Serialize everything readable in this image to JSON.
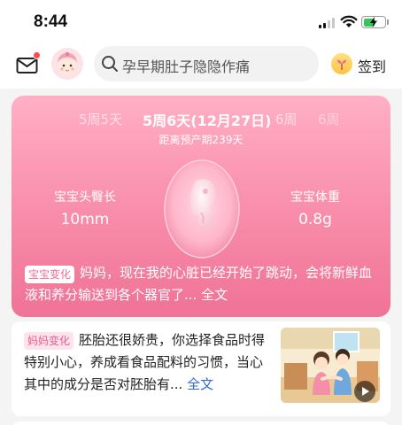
{
  "status_bar": {
    "time": "8:44",
    "battery_level": 0.55
  },
  "header": {
    "search_placeholder": "孕早期肚子隐隐作痛",
    "checkin_label": "签到",
    "has_unread_mail": true
  },
  "baby_card": {
    "weeks": {
      "prev": "5周5天",
      "current": "5周6天(12月27日)",
      "next": "6周",
      "next2": "6周"
    },
    "due_countdown": "距离预产期239天",
    "length": {
      "label": "宝宝头臀长",
      "value": "10mm"
    },
    "weight": {
      "label": "宝宝体重",
      "value": "0.8g"
    },
    "development": {
      "tag": "宝宝变化",
      "text": "妈妈，现在我的心脏已经开始了跳动，会将新鲜血液和养分输送到各个器官了... ",
      "more": "全文"
    },
    "colors": {
      "top": "#ffb0c6",
      "bottom": "#ef7397"
    }
  },
  "article": {
    "tag": "妈妈变化",
    "text": "胚胎还很娇贵，你选择食品时得特别小心，养成看食品配料的习惯，当心其中的成分是否对胚胎有... ",
    "more": "全文",
    "thumbnail_icon": "video-play-icon"
  }
}
